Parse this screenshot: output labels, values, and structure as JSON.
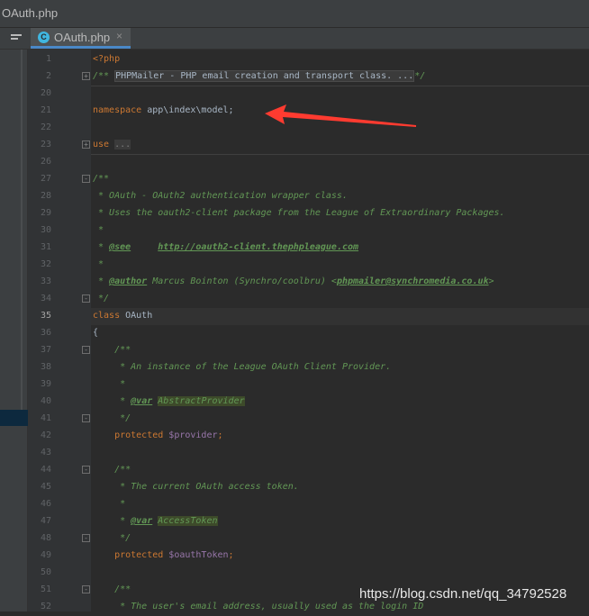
{
  "window": {
    "title": "OAuth.php"
  },
  "tabs": [
    {
      "label": "OAuth.php",
      "icon": "php-class-icon",
      "close_glyph": "×"
    }
  ],
  "colors": {
    "background": "#2b2b2b",
    "gutter": "#313335",
    "keyword": "#cc7832",
    "doc_comment": "#629755",
    "variable": "#9876aa",
    "arrow": "#ff3b30"
  },
  "lines": [
    {
      "num": "1",
      "parts": [
        {
          "t": "<?php",
          "c": "kw"
        }
      ]
    },
    {
      "num": "2",
      "fold": "+",
      "parts": [
        {
          "t": "/** ",
          "c": "doc"
        },
        {
          "t": "PHPMailer - PHP email creation and transport class. ...",
          "c": "fold-text"
        },
        {
          "t": "*/",
          "c": "doc"
        }
      ]
    },
    {
      "num": "20",
      "parts": []
    },
    {
      "num": "21",
      "parts": [
        {
          "t": "namespace ",
          "c": "kw"
        },
        {
          "t": "app\\index\\model;",
          "c": ""
        }
      ]
    },
    {
      "num": "22",
      "parts": []
    },
    {
      "num": "23",
      "fold": "+",
      "parts": [
        {
          "t": "use ",
          "c": "kw"
        },
        {
          "t": "...",
          "c": "folded-dots"
        }
      ]
    },
    {
      "num": "26",
      "parts": []
    },
    {
      "num": "27",
      "fold": "-",
      "parts": [
        {
          "t": "/**",
          "c": "doc"
        }
      ]
    },
    {
      "num": "28",
      "parts": [
        {
          "t": " * OAuth - OAuth2 authentication wrapper class.",
          "c": "doc"
        }
      ]
    },
    {
      "num": "29",
      "parts": [
        {
          "t": " * Uses the oauth2-client package from the League of Extraordinary Packages.",
          "c": "doc"
        }
      ]
    },
    {
      "num": "30",
      "parts": [
        {
          "t": " *",
          "c": "doc"
        }
      ]
    },
    {
      "num": "31",
      "parts": [
        {
          "t": " * ",
          "c": "doc"
        },
        {
          "t": "@see",
          "c": "tag"
        },
        {
          "t": "     ",
          "c": "doc"
        },
        {
          "t": "http://oauth2-client.thephpleague.com",
          "c": "link"
        }
      ]
    },
    {
      "num": "32",
      "parts": [
        {
          "t": " *",
          "c": "doc"
        }
      ]
    },
    {
      "num": "33",
      "parts": [
        {
          "t": " * ",
          "c": "doc"
        },
        {
          "t": "@author",
          "c": "tag"
        },
        {
          "t": " Marcus Bointon (Synchro/coolbru) <",
          "c": "doc"
        },
        {
          "t": "phpmailer@synchromedia.co.uk",
          "c": "link"
        },
        {
          "t": ">",
          "c": "doc"
        }
      ]
    },
    {
      "num": "34",
      "fold": "-",
      "parts": [
        {
          "t": " */",
          "c": "doc"
        }
      ]
    },
    {
      "num": "35",
      "current": true,
      "parts": [
        {
          "t": "class ",
          "c": "kw"
        },
        {
          "t": "OAuth",
          "c": ""
        }
      ]
    },
    {
      "num": "36",
      "parts": [
        {
          "t": "{",
          "c": ""
        }
      ]
    },
    {
      "num": "37",
      "fold": "-",
      "parts": [
        {
          "t": "    /**",
          "c": "doc"
        }
      ]
    },
    {
      "num": "38",
      "parts": [
        {
          "t": "     * An instance of the League OAuth Client Provider.",
          "c": "doc"
        }
      ]
    },
    {
      "num": "39",
      "parts": [
        {
          "t": "     *",
          "c": "doc"
        }
      ]
    },
    {
      "num": "40",
      "parts": [
        {
          "t": "     * ",
          "c": "doc"
        },
        {
          "t": "@var",
          "c": "tag"
        },
        {
          "t": " ",
          "c": "doc"
        },
        {
          "t": "AbstractProvider",
          "c": "doc type-hl"
        }
      ]
    },
    {
      "num": "41",
      "fold": "-",
      "parts": [
        {
          "t": "     */",
          "c": "doc"
        }
      ]
    },
    {
      "num": "42",
      "parts": [
        {
          "t": "    protected ",
          "c": "kw"
        },
        {
          "t": "$provider",
          "c": "var"
        },
        {
          "t": ";",
          "c": "kw"
        }
      ]
    },
    {
      "num": "43",
      "parts": []
    },
    {
      "num": "44",
      "fold": "-",
      "parts": [
        {
          "t": "    /**",
          "c": "doc"
        }
      ]
    },
    {
      "num": "45",
      "parts": [
        {
          "t": "     * The current OAuth access token.",
          "c": "doc"
        }
      ]
    },
    {
      "num": "46",
      "parts": [
        {
          "t": "     *",
          "c": "doc"
        }
      ]
    },
    {
      "num": "47",
      "parts": [
        {
          "t": "     * ",
          "c": "doc"
        },
        {
          "t": "@var",
          "c": "tag"
        },
        {
          "t": " ",
          "c": "doc"
        },
        {
          "t": "AccessToken",
          "c": "doc type-hl"
        }
      ]
    },
    {
      "num": "48",
      "fold": "-",
      "parts": [
        {
          "t": "     */",
          "c": "doc"
        }
      ]
    },
    {
      "num": "49",
      "parts": [
        {
          "t": "    protected ",
          "c": "kw"
        },
        {
          "t": "$oauthToken",
          "c": "var"
        },
        {
          "t": ";",
          "c": "kw"
        }
      ]
    },
    {
      "num": "50",
      "parts": []
    },
    {
      "num": "51",
      "fold": "-",
      "parts": [
        {
          "t": "    /**",
          "c": "doc"
        }
      ]
    },
    {
      "num": "52",
      "parts": [
        {
          "t": "     * The user's email address, usually used as the login ID",
          "c": "doc"
        }
      ]
    }
  ],
  "watermark": "https://blog.csdn.net/qq_34792528"
}
